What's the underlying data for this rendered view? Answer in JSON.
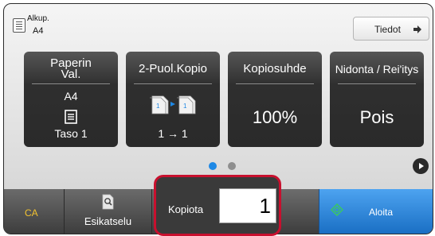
{
  "header": {
    "original_label": "Alkup.",
    "original_size": "A4",
    "details_label": "Tiedot"
  },
  "cards": {
    "paper": {
      "title_line1": "Paperin",
      "title_line2": "Val.",
      "size": "A4",
      "tray": "Taso 1"
    },
    "duplex": {
      "title": "2-Puol.Kopio",
      "mode": "1 → 1"
    },
    "ratio": {
      "title": "Kopiosuhde",
      "value": "100%"
    },
    "finishing": {
      "title": "Nidonta / Rei'itys",
      "value": "Pois"
    }
  },
  "pager": {
    "pages": 2,
    "current": 1
  },
  "bottom": {
    "ca_label": "CA",
    "preview_label": "Esikatselu",
    "copies_label": "Kopiota",
    "copies_value": "1",
    "start_label": "Aloita"
  },
  "colors": {
    "ca_text": "#f2c230",
    "highlight": "#c8102e",
    "start": "#2f8ae0",
    "active_dot": "#1e88e5",
    "start_icon": "#39c46a"
  },
  "icons": {
    "original": "document-icon",
    "details": "arrow-right-icon",
    "tray": "tray-icon",
    "duplex": "duplex-pages-icon",
    "preview": "magnifier-page-icon",
    "next": "play-next-icon",
    "start": "start-diamond-icon"
  }
}
